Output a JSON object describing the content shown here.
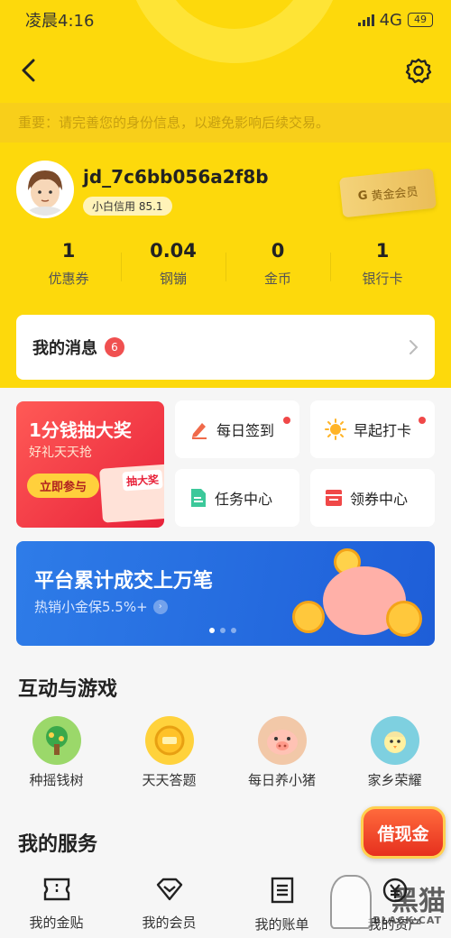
{
  "status_bar": {
    "time": "凌晨4:16",
    "network": "4G",
    "battery": "49"
  },
  "notice": "重要：请完善您的身份信息，以避免影响后续交易。",
  "profile": {
    "username": "jd_7c6bb056a2f8b",
    "credit": "小白信用 85.1",
    "member_badge": "黄金会员"
  },
  "stats": [
    {
      "value": "1",
      "label": "优惠券"
    },
    {
      "value": "0.04",
      "label": "钢镚"
    },
    {
      "value": "0",
      "label": "金币"
    },
    {
      "value": "1",
      "label": "银行卡"
    }
  ],
  "messages": {
    "title": "我的消息",
    "count": "6"
  },
  "promo": {
    "title": "1分钱抽大奖",
    "subtitle": "好礼天天抢",
    "button": "立即参与",
    "box_text": "抽大奖"
  },
  "tiles": [
    {
      "label": "每日签到",
      "icon": "pencil-icon",
      "dot": true
    },
    {
      "label": "早起打卡",
      "icon": "sun-icon",
      "dot": true
    },
    {
      "label": "任务中心",
      "icon": "document-icon",
      "dot": false
    },
    {
      "label": "领券中心",
      "icon": "ticket-icon",
      "dot": false
    }
  ],
  "banner": {
    "title": "平台累计成交上万笔",
    "subtitle": "热销小金保5.5%+",
    "active_slide": 1,
    "slides": 3
  },
  "games": {
    "title": "互动与游戏",
    "items": [
      {
        "label": "种摇钱树",
        "icon": "money-tree-icon"
      },
      {
        "label": "天天答题",
        "icon": "quiz-coin-icon"
      },
      {
        "label": "每日养小猪",
        "icon": "pig-icon"
      },
      {
        "label": "家乡荣耀",
        "icon": "chick-icon"
      }
    ]
  },
  "loan_button": "借现金",
  "services": {
    "title": "我的服务",
    "items": [
      {
        "label": "我的金贴",
        "icon": "coupon-icon"
      },
      {
        "label": "我的会员",
        "icon": "diamond-icon"
      },
      {
        "label": "我的账单",
        "icon": "bill-icon"
      },
      {
        "label": "我的资产",
        "icon": "asset-icon"
      }
    ]
  },
  "watermark": {
    "big": "黑猫",
    "small": "BLACK CAT"
  },
  "colors": {
    "brand_yellow": "#fdd90c",
    "notice_bg": "#f8cf1a",
    "badge_red": "#f05050",
    "banner_blue": "#2e7ce8"
  }
}
